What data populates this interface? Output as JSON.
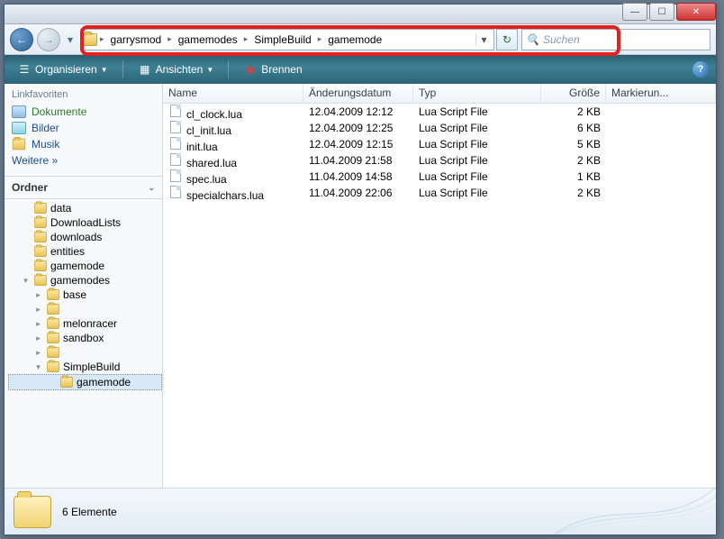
{
  "window_controls": {
    "min": "—",
    "max": "☐",
    "close": "✕"
  },
  "nav": {
    "back_glyph": "←",
    "fwd_glyph": "→"
  },
  "breadcrumbs": [
    "garrysmod",
    "gamemodes",
    "SimpleBuild",
    "gamemode"
  ],
  "breadcrumb_sep": "▸",
  "refresh_glyph": "↻",
  "search_placeholder": "Suchen",
  "toolbar": {
    "organize": "Organisieren",
    "views": "Ansichten",
    "burn": "Brennen"
  },
  "favorites": {
    "header": "Linkfavoriten",
    "items": [
      {
        "label": "Dokumente",
        "icon": "docs"
      },
      {
        "label": "Bilder",
        "icon": "pics"
      },
      {
        "label": "Musik",
        "icon": "folder"
      }
    ],
    "more": "Weitere »"
  },
  "folders_header": "Ordner",
  "tree": [
    {
      "label": "data",
      "ind": 1,
      "exp": ""
    },
    {
      "label": "DownloadLists",
      "ind": 1,
      "exp": ""
    },
    {
      "label": "downloads",
      "ind": 1,
      "exp": ""
    },
    {
      "label": "entities",
      "ind": 1,
      "exp": ""
    },
    {
      "label": "gamemode",
      "ind": 1,
      "exp": ""
    },
    {
      "label": "gamemodes",
      "ind": 1,
      "exp": "▾"
    },
    {
      "label": "base",
      "ind": 2,
      "exp": "▸"
    },
    {
      "label": "",
      "ind": 2,
      "exp": "▸"
    },
    {
      "label": "melonracer",
      "ind": 2,
      "exp": "▸"
    },
    {
      "label": "sandbox",
      "ind": 2,
      "exp": "▸"
    },
    {
      "label": "",
      "ind": 2,
      "exp": "▸"
    },
    {
      "label": "SimpleBuild",
      "ind": 2,
      "exp": "▾"
    },
    {
      "label": "gamemode",
      "ind": 3,
      "exp": "",
      "sel": true
    }
  ],
  "columns": {
    "name": "Name",
    "date": "Änderungsdatum",
    "type": "Typ",
    "size": "Größe",
    "tags": "Markierun..."
  },
  "files": [
    {
      "name": "cl_clock.lua",
      "date": "12.04.2009 12:12",
      "type": "Lua Script File",
      "size": "2 KB"
    },
    {
      "name": "cl_init.lua",
      "date": "12.04.2009 12:25",
      "type": "Lua Script File",
      "size": "6 KB"
    },
    {
      "name": "init.lua",
      "date": "12.04.2009 12:15",
      "type": "Lua Script File",
      "size": "5 KB"
    },
    {
      "name": "shared.lua",
      "date": "11.04.2009 21:58",
      "type": "Lua Script File",
      "size": "2 KB"
    },
    {
      "name": "spec.lua",
      "date": "11.04.2009 14:58",
      "type": "Lua Script File",
      "size": "1 KB"
    },
    {
      "name": "specialchars.lua",
      "date": "11.04.2009 22:06",
      "type": "Lua Script File",
      "size": "2 KB"
    }
  ],
  "status": {
    "count_text": "6 Elemente"
  }
}
